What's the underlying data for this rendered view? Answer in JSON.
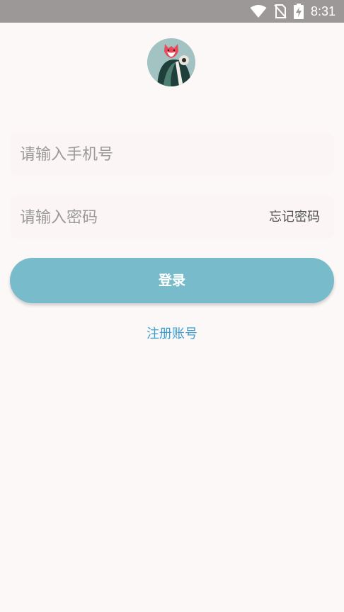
{
  "status_bar": {
    "time": "8:31",
    "icons": [
      "wifi-icon",
      "no-sim-icon",
      "battery-charging-icon"
    ],
    "background": "#9c9898"
  },
  "logo": {
    "icon": "fox-avatar-icon"
  },
  "login_form": {
    "phone_placeholder": "请输入手机号",
    "password_placeholder": "请输入密码",
    "forgot_password_label": "忘记密码",
    "login_button_label": "登录",
    "register_link_label": "注册账号"
  },
  "colors": {
    "accent": "#78bccb",
    "link": "#3a9fcf",
    "background": "#fdf8f8"
  }
}
